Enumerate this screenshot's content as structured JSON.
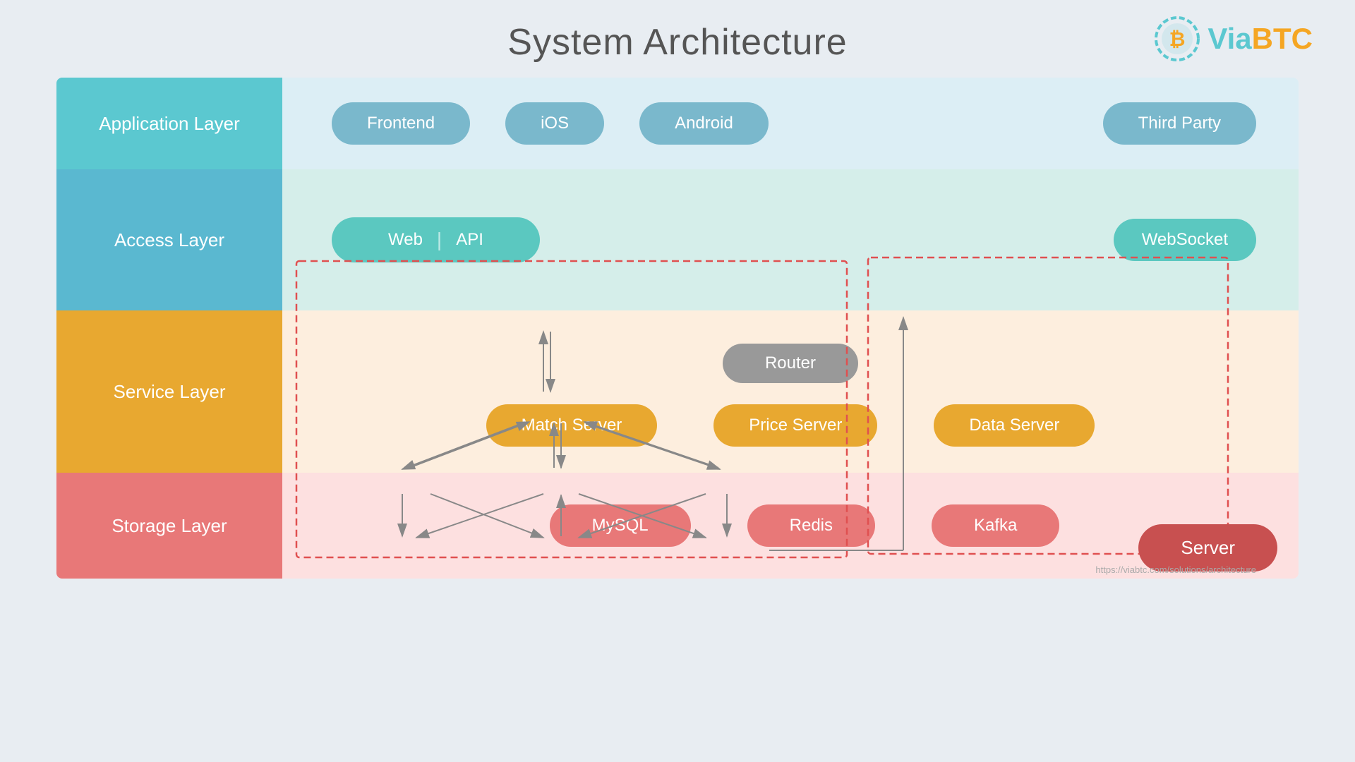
{
  "header": {
    "title": "System Architecture",
    "logo": {
      "via": "Via",
      "btc": "BTC",
      "icon_title": "Bitcoin"
    }
  },
  "layers": {
    "application": {
      "label": "Application Layer",
      "items": [
        "Frontend",
        "iOS",
        "Android",
        "Third Party"
      ]
    },
    "access": {
      "label": "Access Layer",
      "items": [
        "Web",
        "|",
        "API",
        "WebSocket"
      ]
    },
    "service": {
      "label": "Service Layer",
      "router": "Router",
      "servers": [
        "Match Server",
        "Price Server",
        "Data Server"
      ]
    },
    "storage": {
      "label": "Storage Layer",
      "items": [
        "MySQL",
        "Redis",
        "Kafka"
      ],
      "server_label": "Server"
    }
  },
  "watermark": "https://viabtc.com/solutions/architecture"
}
